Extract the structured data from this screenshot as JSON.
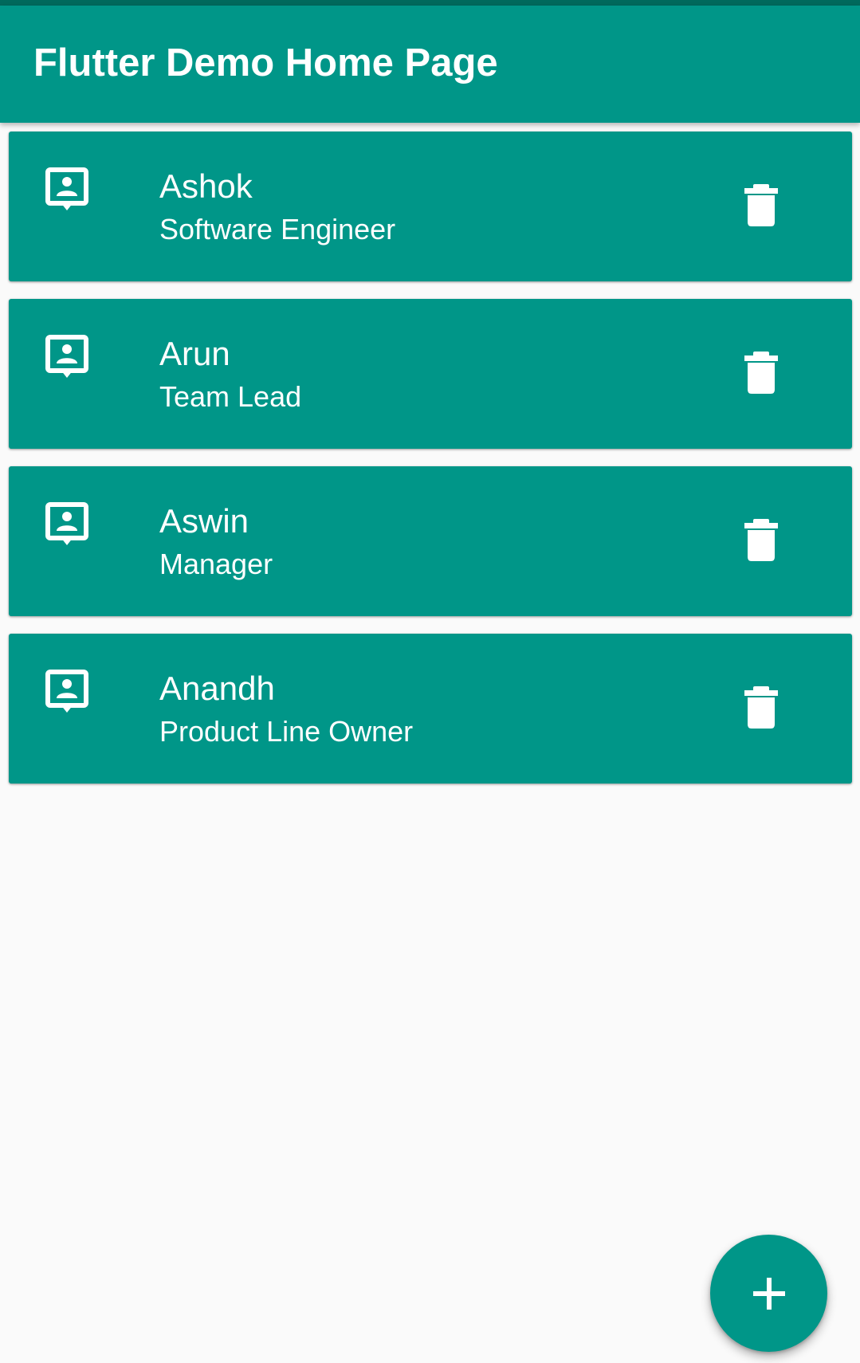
{
  "app_bar": {
    "title": "Flutter Demo Home Page"
  },
  "colors": {
    "primary": "#009688",
    "status_bar": "#00695c",
    "background": "#fafafa",
    "on_primary": "#ffffff"
  },
  "contacts": [
    {
      "name": "Ashok",
      "role": "Software Engineer",
      "icon": "contact-mail-icon",
      "action_icon": "delete-icon"
    },
    {
      "name": "Arun",
      "role": "Team Lead",
      "icon": "contact-mail-icon",
      "action_icon": "delete-icon"
    },
    {
      "name": "Aswin",
      "role": "Manager",
      "icon": "contact-mail-icon",
      "action_icon": "delete-icon"
    },
    {
      "name": "Anandh",
      "role": "Product Line Owner",
      "icon": "contact-mail-icon",
      "action_icon": "delete-icon"
    }
  ],
  "fab": {
    "icon": "add-icon"
  }
}
